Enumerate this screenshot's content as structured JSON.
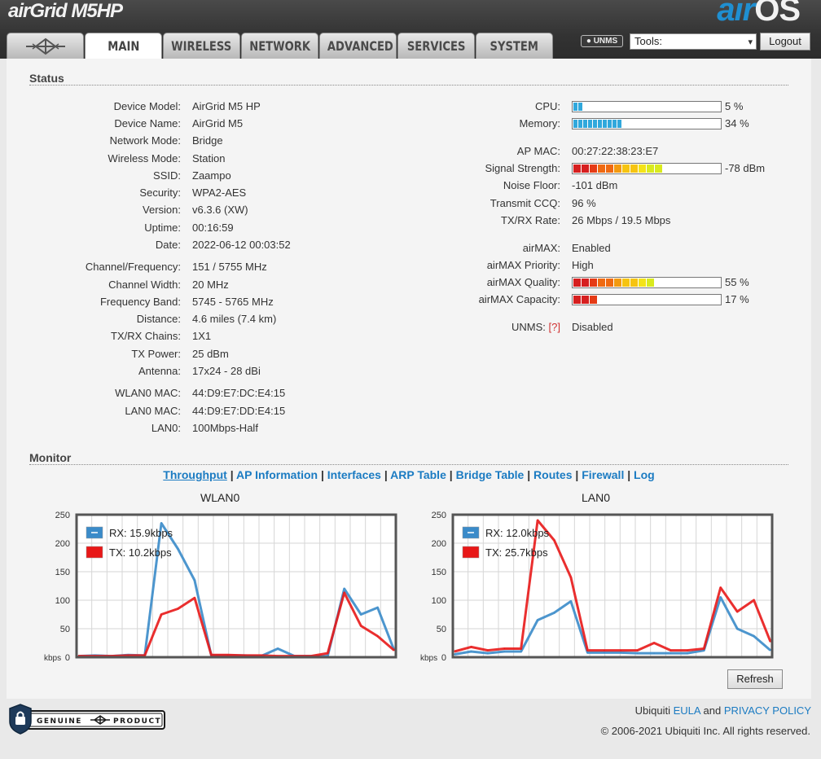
{
  "header": {
    "product_logo": "airGrid M5HP",
    "brand_logo_air": "air",
    "brand_logo_os": "OS",
    "tabs": [
      {
        "label": "",
        "icon": "ubiquiti-logo-icon"
      },
      {
        "label": "MAIN"
      },
      {
        "label": "WIRELESS"
      },
      {
        "label": "NETWORK"
      },
      {
        "label": "ADVANCED"
      },
      {
        "label": "SERVICES"
      },
      {
        "label": "SYSTEM"
      }
    ],
    "active_tab": "MAIN",
    "unms_badge": "UNMS",
    "tools_select": "Tools:",
    "logout_label": "Logout"
  },
  "status": {
    "title": "Status",
    "left": [
      {
        "label": "Device Model:",
        "value": "AirGrid M5 HP"
      },
      {
        "label": "Device Name:",
        "value": "AirGrid M5"
      },
      {
        "label": "Network Mode:",
        "value": "Bridge"
      },
      {
        "label": "Wireless Mode:",
        "value": "Station"
      },
      {
        "label": "SSID:",
        "value": "Zaampo"
      },
      {
        "label": "Security:",
        "value": "WPA2-AES"
      },
      {
        "label": "Version:",
        "value": "v6.3.6 (XW)"
      },
      {
        "label": "Uptime:",
        "value": "00:16:59"
      },
      {
        "label": "Date:",
        "value": "2022-06-12 00:03:52"
      },
      {
        "label": "Channel/Frequency:",
        "value": "151 / 5755 MHz"
      },
      {
        "label": "Channel Width:",
        "value": "20 MHz"
      },
      {
        "label": "Frequency Band:",
        "value": "5745 - 5765 MHz"
      },
      {
        "label": "Distance:",
        "value": "4.6 miles (7.4 km)"
      },
      {
        "label": "TX/RX Chains:",
        "value": "1X1"
      },
      {
        "label": "TX Power:",
        "value": "25 dBm"
      },
      {
        "label": "Antenna:",
        "value": "17x24 - 28 dBi"
      },
      {
        "label": "WLAN0 MAC:",
        "value": "44:D9:E7:DC:E4:15"
      },
      {
        "label": "LAN0 MAC:",
        "value": "44:D9:E7:DD:E4:15"
      },
      {
        "label": "LAN0:",
        "value": "100Mbps-Half"
      }
    ],
    "cpu": {
      "label": "CPU:",
      "value": "5 %",
      "percent": 5
    },
    "memory": {
      "label": "Memory:",
      "value": "34 %",
      "percent": 34
    },
    "ap_mac": {
      "label": "AP MAC:",
      "value": "00:27:22:38:23:E7"
    },
    "signal": {
      "label": "Signal Strength:",
      "value": "-78 dBm",
      "percent": 60
    },
    "noise_floor": {
      "label": "Noise Floor:",
      "value": "-101 dBm"
    },
    "transmit_ccq": {
      "label": "Transmit CCQ:",
      "value": "96 %"
    },
    "txrx_rate": {
      "label": "TX/RX Rate:",
      "value": "26 Mbps / 19.5 Mbps"
    },
    "airmax": {
      "label": "airMAX:",
      "value": "Enabled"
    },
    "airmax_priority": {
      "label": "airMAX Priority:",
      "value": "High"
    },
    "airmax_quality": {
      "label": "airMAX Quality:",
      "value": "55 %",
      "percent": 55
    },
    "airmax_capacity": {
      "label": "airMAX Capacity:",
      "value": "17 %",
      "percent": 17
    },
    "unms": {
      "label": "UNMS:",
      "help": "[?]",
      "value": "Disabled"
    }
  },
  "monitor": {
    "title": "Monitor",
    "links": [
      "Throughput",
      "AP Information",
      "Interfaces",
      "ARP Table",
      "Bridge Table",
      "Routes",
      "Firewall",
      "Log"
    ],
    "active_link": "Throughput",
    "refresh_label": "Refresh"
  },
  "chart_data": [
    {
      "type": "line",
      "title": "WLAN0",
      "ylabel": "kbps",
      "ylim": [
        0,
        250
      ],
      "yticks": [
        0,
        50,
        100,
        150,
        200,
        250
      ],
      "x": [
        0,
        1,
        2,
        3,
        4,
        5,
        6,
        7,
        8,
        9,
        10,
        11,
        12,
        13,
        14,
        15,
        16,
        17,
        18,
        19,
        20
      ],
      "series": [
        {
          "name": "RX: 15.9kbps",
          "color": "#3a8bc9",
          "values": [
            2,
            3,
            2,
            4,
            3,
            235,
            190,
            135,
            3,
            3,
            3,
            2,
            15,
            2,
            2,
            2,
            120,
            75,
            87,
            12
          ]
        },
        {
          "name": "TX: 10.2kbps",
          "color": "#e81818",
          "values": [
            2,
            2,
            2,
            3,
            3,
            75,
            85,
            104,
            4,
            4,
            3,
            3,
            2,
            2,
            2,
            7,
            113,
            55,
            37,
            12
          ]
        }
      ]
    },
    {
      "type": "line",
      "title": "LAN0",
      "ylabel": "kbps",
      "ylim": [
        0,
        250
      ],
      "yticks": [
        0,
        50,
        100,
        150,
        200,
        250
      ],
      "x": [
        0,
        1,
        2,
        3,
        4,
        5,
        6,
        7,
        8,
        9,
        10,
        11,
        12,
        13,
        14,
        15,
        16,
        17,
        18,
        19,
        20
      ],
      "series": [
        {
          "name": "RX: 12.0kbps",
          "color": "#3a8bc9",
          "values": [
            5,
            10,
            7,
            10,
            10,
            65,
            78,
            98,
            8,
            8,
            8,
            7,
            7,
            7,
            7,
            12,
            105,
            50,
            37,
            12
          ]
        },
        {
          "name": "TX: 25.7kbps",
          "color": "#e81818",
          "values": [
            10,
            18,
            12,
            15,
            15,
            240,
            205,
            140,
            12,
            12,
            12,
            12,
            25,
            12,
            12,
            15,
            122,
            80,
            100,
            27
          ]
        }
      ]
    }
  ],
  "footer": {
    "badge_text_left": "GENUINE",
    "badge_text_right": "PRODUCT",
    "company": "Ubiquiti",
    "eula": "EULA",
    "and": "and",
    "privacy": "PRIVACY POLICY",
    "copyright": "© 2006-2021 Ubiquiti Inc. All rights reserved."
  },
  "colors": {
    "link": "#1b7bc2",
    "rx": "#3a8bc9",
    "tx": "#e81818",
    "cpu_fill": "#31a8dc"
  }
}
